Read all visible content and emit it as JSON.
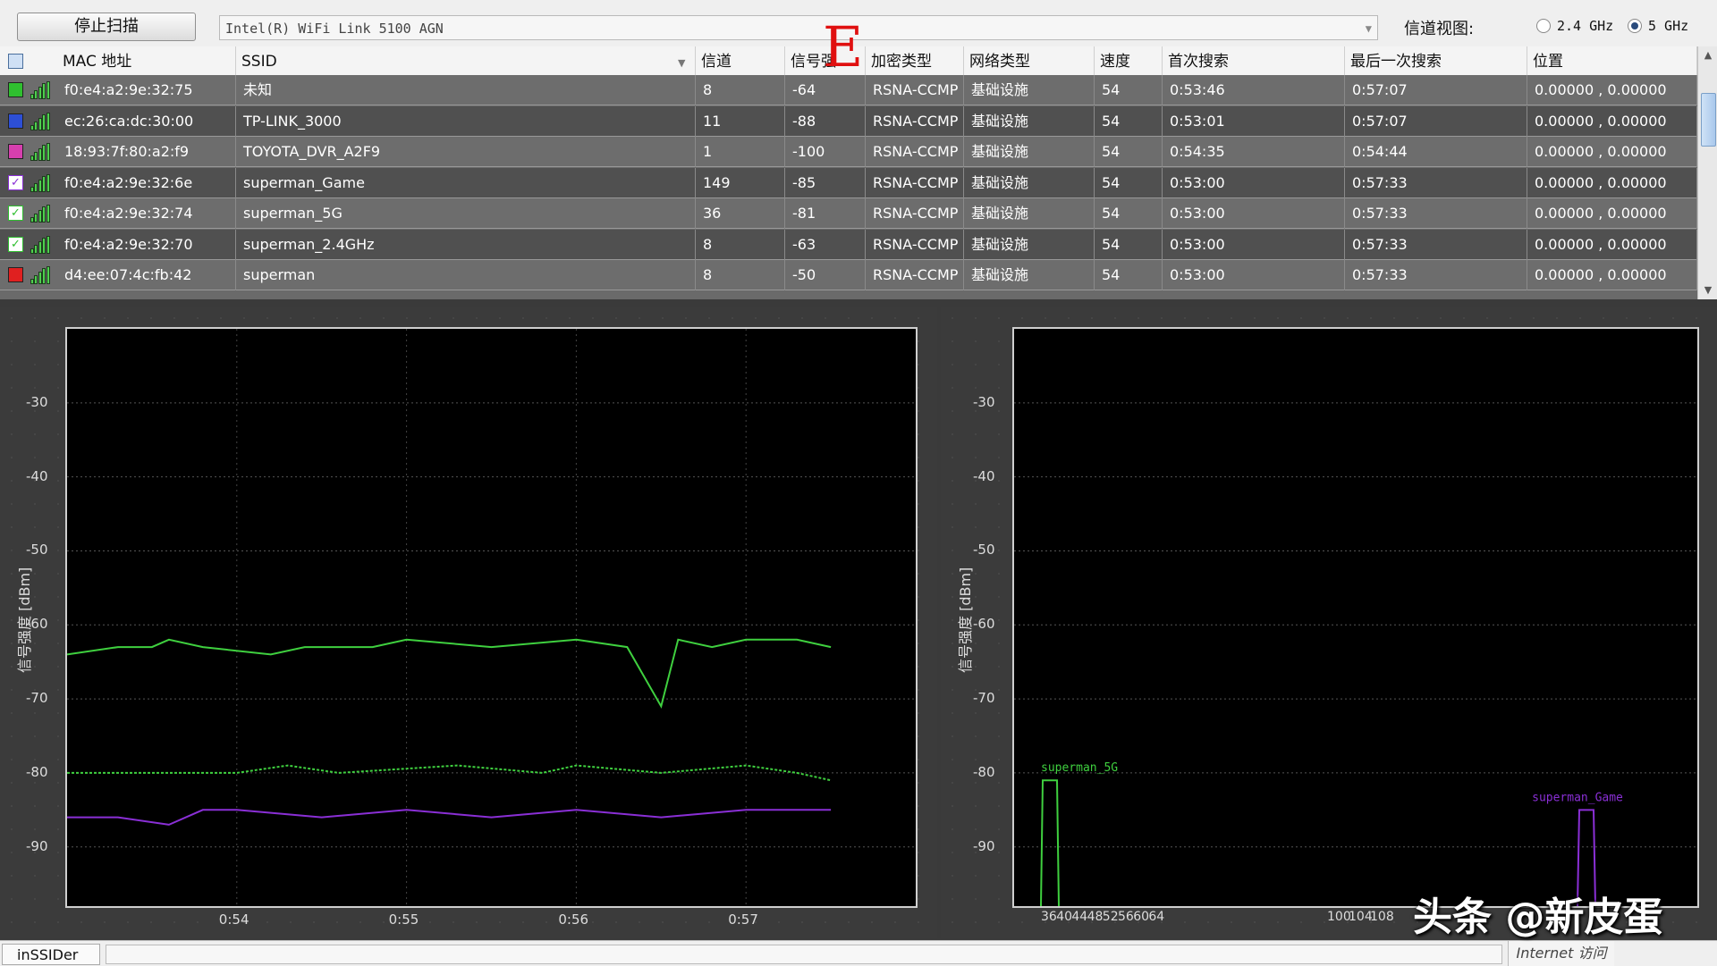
{
  "toolbar": {
    "stop_scan": "停止扫描",
    "adapter": "Intel(R) WiFi Link 5100 AGN",
    "channel_view_label": "信道视图:",
    "band_24": "2.4 GHz",
    "band_5": "5 GHz",
    "selected_band": "5 GHz"
  },
  "overlay_mark": "E",
  "table": {
    "columns": [
      "MAC 地址",
      "SSID",
      "信道",
      "信号强",
      "加密类型",
      "网络类型",
      "速度",
      "首次搜索",
      "最后一次搜索",
      "位置"
    ],
    "rows": [
      {
        "checked": false,
        "color": "#2fbf2f",
        "mac": "f0:e4:a2:9e:32:75",
        "ssid": "未知",
        "channel": "8",
        "signal": "-64",
        "enc": "RSNA-CCMP",
        "net": "基础设施",
        "speed": "54",
        "first": "0:53:46",
        "last": "0:57:07",
        "pos": "0.00000 , 0.00000"
      },
      {
        "checked": false,
        "color": "#2d4fd6",
        "mac": "ec:26:ca:dc:30:00",
        "ssid": "TP-LINK_3000",
        "channel": "11",
        "signal": "-88",
        "enc": "RSNA-CCMP",
        "net": "基础设施",
        "speed": "54",
        "first": "0:53:01",
        "last": "0:57:07",
        "pos": "0.00000 , 0.00000"
      },
      {
        "checked": false,
        "color": "#d63fae",
        "mac": "18:93:7f:80:a2:f9",
        "ssid": "TOYOTA_DVR_A2F9",
        "channel": "1",
        "signal": "-100",
        "enc": "RSNA-CCMP",
        "net": "基础设施",
        "speed": "54",
        "first": "0:54:35",
        "last": "0:54:44",
        "pos": "0.00000 , 0.00000"
      },
      {
        "checked": true,
        "color": "#8a2fd6",
        "mac": "f0:e4:a2:9e:32:6e",
        "ssid": "superman_Game",
        "channel": "149",
        "signal": "-85",
        "enc": "RSNA-CCMP",
        "net": "基础设施",
        "speed": "54",
        "first": "0:53:00",
        "last": "0:57:33",
        "pos": "0.00000 , 0.00000"
      },
      {
        "checked": true,
        "color": "#2fbf2f",
        "mac": "f0:e4:a2:9e:32:74",
        "ssid": "superman_5G",
        "channel": "36",
        "signal": "-81",
        "enc": "RSNA-CCMP",
        "net": "基础设施",
        "speed": "54",
        "first": "0:53:00",
        "last": "0:57:33",
        "pos": "0.00000 , 0.00000"
      },
      {
        "checked": true,
        "color": "#2fbf2f",
        "mac": "f0:e4:a2:9e:32:70",
        "ssid": "superman_2.4GHz",
        "channel": "8",
        "signal": "-63",
        "enc": "RSNA-CCMP",
        "net": "基础设施",
        "speed": "54",
        "first": "0:53:00",
        "last": "0:57:33",
        "pos": "0.00000 , 0.00000"
      },
      {
        "checked": false,
        "color": "#e02020",
        "mac": "d4:ee:07:4c:fb:42",
        "ssid": "superman",
        "channel": "8",
        "signal": "-50",
        "enc": "RSNA-CCMP",
        "net": "基础设施",
        "speed": "54",
        "first": "0:53:00",
        "last": "0:57:33",
        "pos": "0.00000 , 0.00000"
      }
    ]
  },
  "chart_data": [
    {
      "type": "line",
      "ylabel": "信号强度 [dBm]",
      "yticks": [
        -30,
        -40,
        -50,
        -60,
        -70,
        -80,
        -90
      ],
      "ylim": [
        -98,
        -20
      ],
      "xticks": [
        "0:54",
        "0:55",
        "0:56",
        "0:57"
      ],
      "xlim_minutes": [
        53.0,
        58.0
      ],
      "grid": true,
      "series": [
        {
          "color": "#3fd03f",
          "dash": false,
          "points": [
            [
              53.0,
              -64
            ],
            [
              53.3,
              -63
            ],
            [
              53.5,
              -63
            ],
            [
              53.6,
              -62
            ],
            [
              53.8,
              -63
            ],
            [
              54.2,
              -64
            ],
            [
              54.4,
              -63
            ],
            [
              54.8,
              -63
            ],
            [
              55.0,
              -62
            ],
            [
              55.5,
              -63
            ],
            [
              56.0,
              -62
            ],
            [
              56.3,
              -63
            ],
            [
              56.5,
              -71
            ],
            [
              56.6,
              -62
            ],
            [
              56.8,
              -63
            ],
            [
              57.0,
              -62
            ],
            [
              57.3,
              -62
            ],
            [
              57.5,
              -63
            ]
          ]
        },
        {
          "color": "#3fd03f",
          "dash": true,
          "points": [
            [
              53.0,
              -80
            ],
            [
              53.3,
              -80
            ],
            [
              54.0,
              -80
            ],
            [
              54.3,
              -79
            ],
            [
              54.6,
              -80
            ],
            [
              55.3,
              -79
            ],
            [
              55.8,
              -80
            ],
            [
              56.0,
              -79
            ],
            [
              56.5,
              -80
            ],
            [
              57.0,
              -79
            ],
            [
              57.3,
              -80
            ],
            [
              57.5,
              -81
            ]
          ]
        },
        {
          "color": "#8a2fd6",
          "dash": false,
          "points": [
            [
              53.0,
              -86
            ],
            [
              53.3,
              -86
            ],
            [
              53.6,
              -87
            ],
            [
              53.8,
              -85
            ],
            [
              54.0,
              -85
            ],
            [
              54.5,
              -86
            ],
            [
              55.0,
              -85
            ],
            [
              55.5,
              -86
            ],
            [
              56.0,
              -85
            ],
            [
              56.5,
              -86
            ],
            [
              57.0,
              -85
            ],
            [
              57.5,
              -85
            ]
          ]
        }
      ]
    },
    {
      "type": "bar",
      "ylabel": "信号强度 [dBm]",
      "yticks": [
        -30,
        -40,
        -50,
        -60,
        -70,
        -80,
        -90
      ],
      "ylim": [
        -98,
        -20
      ],
      "xticks": [
        "36",
        "40",
        "44",
        "48",
        "52",
        "56",
        "60",
        "64",
        "100",
        "104",
        "108"
      ],
      "grid": true,
      "series": [
        {
          "name": "superman_5G",
          "channel": 36,
          "value": -81,
          "color": "#3fd03f"
        },
        {
          "name": "superman_Game",
          "channel": 149,
          "value": -85,
          "color": "#8a2fd6"
        }
      ]
    }
  ],
  "status": {
    "tab": "inSSIDer",
    "zone": "Internet 访问"
  },
  "watermark": "头条 @新皮蛋"
}
